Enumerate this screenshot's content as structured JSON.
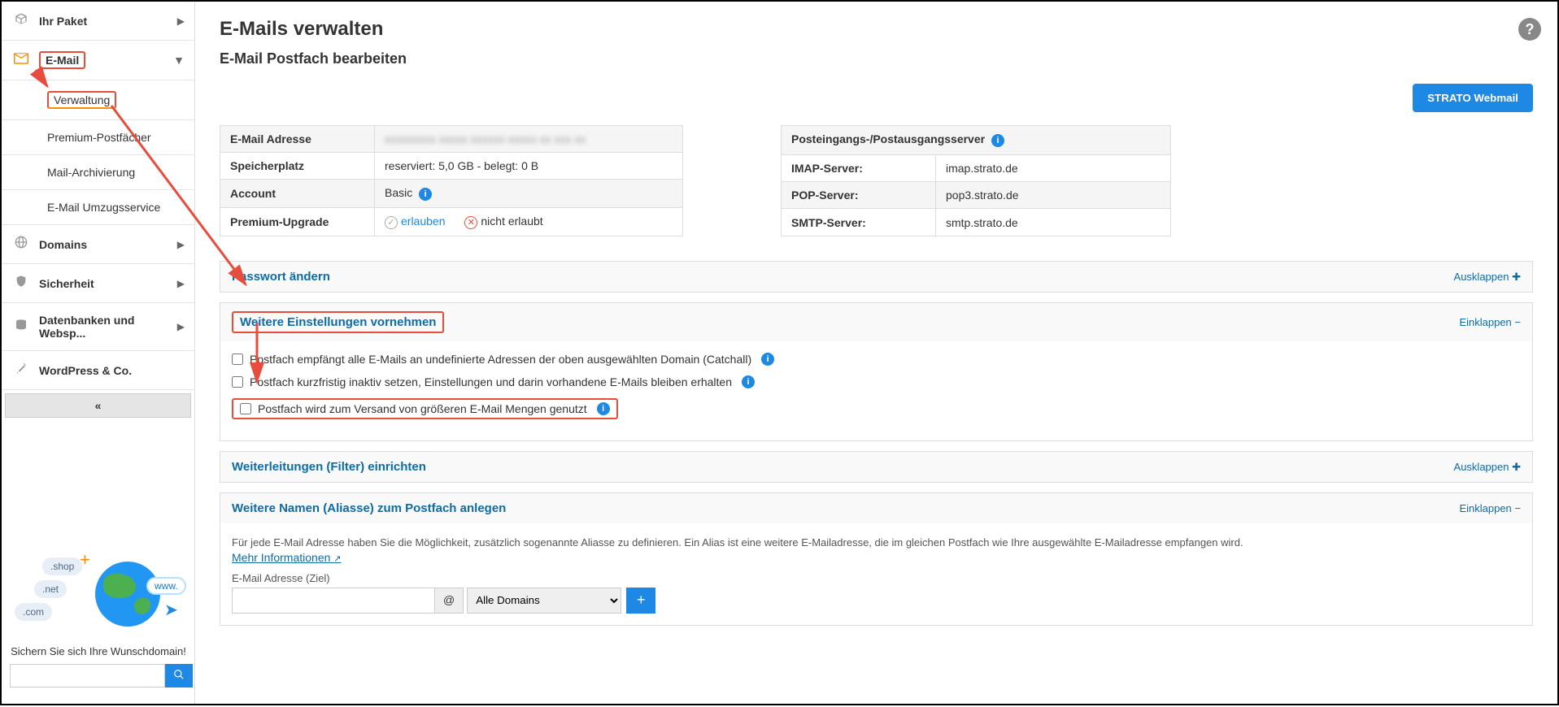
{
  "sidebar": {
    "items": [
      {
        "label": "Ihr Paket"
      },
      {
        "label": "E-Mail"
      },
      {
        "label": "Domains"
      },
      {
        "label": "Sicherheit"
      },
      {
        "label": "Datenbanken und Websp..."
      },
      {
        "label": "WordPress & Co."
      }
    ],
    "sub": {
      "verwaltung": "Verwaltung",
      "premium": "Premium-Postfächer",
      "archiv": "Mail-Archivierung",
      "umzug": "E-Mail Umzugsservice"
    },
    "collapse_glyph": "«"
  },
  "promo": {
    "bubbles": {
      "shop": ".shop",
      "net": ".net",
      "com": ".com",
      "www": "www.",
      "plus": "+"
    },
    "tagline": "Sichern Sie sich Ihre Wunschdomain!"
  },
  "header": {
    "title": "E-Mails verwalten",
    "subtitle": "E-Mail Postfach bearbeiten",
    "webmail_btn": "STRATO Webmail",
    "help": "?"
  },
  "table_left": {
    "r1_label": "E-Mail Adresse",
    "r1_value": "",
    "r2_label": "Speicherplatz",
    "r2_value": "reserviert: 5,0 GB - belegt: 0 B",
    "r3_label": "Account",
    "r3_value": "Basic",
    "r4_label": "Premium-Upgrade",
    "r4_allow": "erlauben",
    "r4_deny": "nicht erlaubt"
  },
  "table_right": {
    "r1_label": "Posteingangs-/Postausgangsserver",
    "r2_label": "IMAP-Server:",
    "r2_value": "imap.strato.de",
    "r3_label": "POP-Server:",
    "r3_value": "pop3.strato.de",
    "r4_label": "SMTP-Server:",
    "r4_value": "smtp.strato.de"
  },
  "panels": {
    "password": {
      "title": "Passwort ändern",
      "toggle": "Ausklappen"
    },
    "settings": {
      "title": "Weitere Einstellungen vornehmen",
      "toggle": "Einklappen",
      "opt1": "Postfach empfängt alle E-Mails an undefinierte Adressen der oben ausgewählten Domain (Catchall)",
      "opt2": "Postfach kurzfristig inaktiv setzen, Einstellungen und darin vorhandene E-Mails bleiben erhalten",
      "opt3": "Postfach wird zum Versand von größeren E-Mail Mengen genutzt"
    },
    "filter": {
      "title": "Weiterleitungen (Filter) einrichten",
      "toggle": "Ausklappen"
    },
    "alias": {
      "title": "Weitere Namen (Aliasse) zum Postfach anlegen",
      "toggle": "Einklappen",
      "desc": "Für jede E-Mail Adresse haben Sie die Möglichkeit, zusätzlich sogenannte Aliasse zu definieren. Ein Alias ist eine weitere E-Mailadresse, die im gleichen Postfach wie Ihre ausgewählte E-Mailadresse empfangen wird.",
      "more_link": "Mehr Informationen",
      "field_label": "E-Mail Adresse (Ziel)",
      "at": "@",
      "select_default": "Alle Domains",
      "add": "+"
    }
  }
}
